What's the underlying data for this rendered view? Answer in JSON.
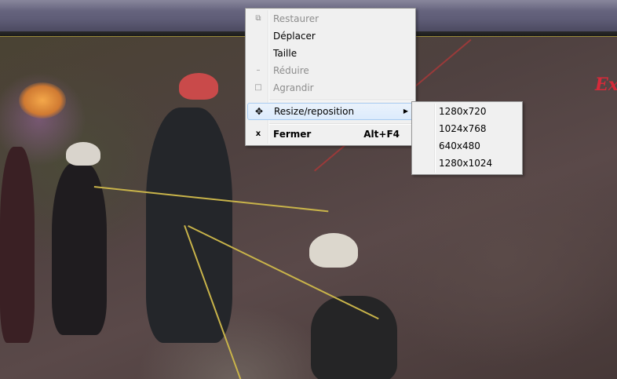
{
  "video": {
    "brand_text": "Ex"
  },
  "context_menu": {
    "items": [
      {
        "label": "Restaurer",
        "icon": "restore-icon",
        "enabled": false
      },
      {
        "label": "Déplacer",
        "enabled": true
      },
      {
        "label": "Taille",
        "enabled": true
      },
      {
        "label": "Réduire",
        "icon": "minimize-icon",
        "enabled": false
      },
      {
        "label": "Agrandir",
        "icon": "maximize-icon",
        "enabled": false
      },
      {
        "label": "Resize/reposition",
        "icon": "move-icon",
        "enabled": true,
        "has_submenu": true,
        "highlighted": true
      },
      {
        "label": "Fermer",
        "icon": "close-icon",
        "icon_glyph": "x",
        "shortcut": "Alt+F4",
        "enabled": true,
        "bold": true
      }
    ]
  },
  "submenu": {
    "items": [
      {
        "label": "1280x720"
      },
      {
        "label": "1024x768"
      },
      {
        "label": "640x480"
      },
      {
        "label": "1280x1024"
      }
    ]
  },
  "colors": {
    "menu_bg": "#f0f0f0",
    "highlight_border": "#a8cbf1",
    "disabled_text": "#8d8d8d",
    "brand": "#d62a3a"
  }
}
